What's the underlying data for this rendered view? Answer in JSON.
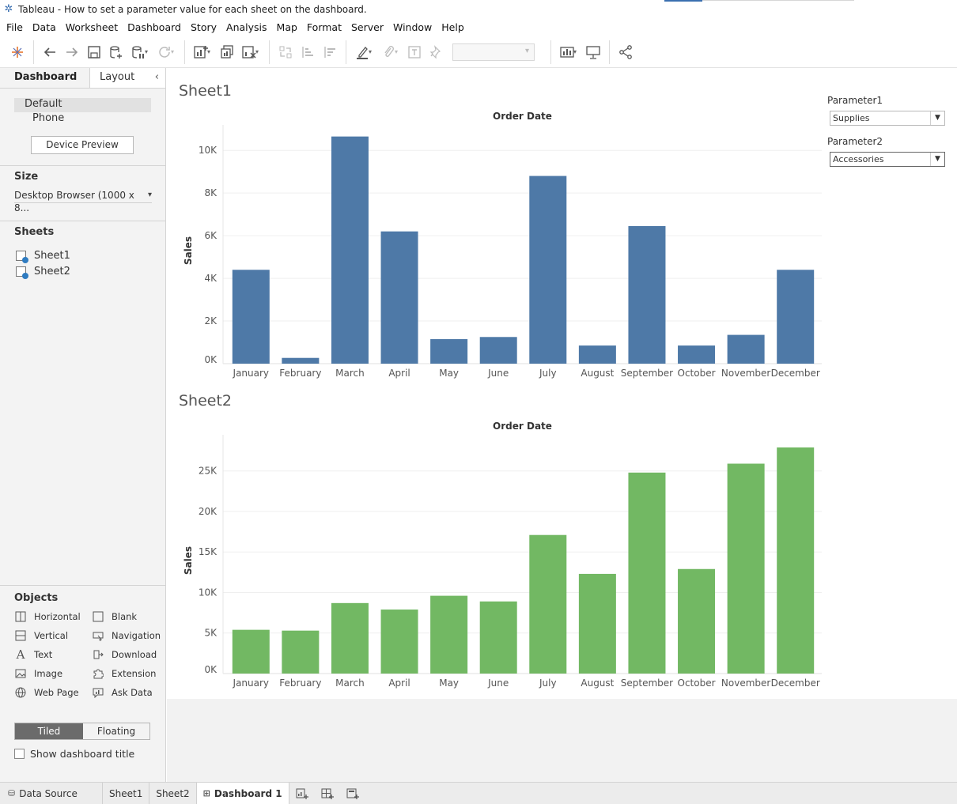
{
  "window": {
    "title": "Tableau - How to set a parameter value for each sheet on the dashboard."
  },
  "menu": [
    "File",
    "Data",
    "Worksheet",
    "Dashboard",
    "Story",
    "Analysis",
    "Map",
    "Format",
    "Server",
    "Window",
    "Help"
  ],
  "left_panel": {
    "tabs": {
      "dashboard": "Dashboard",
      "layout": "Layout"
    },
    "devices": {
      "default": "Default",
      "phone": "Phone"
    },
    "device_preview": "Device Preview",
    "size": {
      "heading": "Size",
      "value": "Desktop Browser (1000 x 8..."
    },
    "sheets": {
      "heading": "Sheets",
      "items": [
        "Sheet1",
        "Sheet2"
      ]
    },
    "objects": {
      "heading": "Objects",
      "items": [
        "Horizontal",
        "Blank",
        "Vertical",
        "Navigation",
        "Text",
        "Download",
        "Image",
        "Extension",
        "Web Page",
        "Ask Data"
      ]
    },
    "tiling": {
      "tiled": "Tiled",
      "floating": "Floating"
    },
    "show_title": "Show dashboard title"
  },
  "parameters": [
    {
      "label": "Parameter1",
      "value": "Supplies"
    },
    {
      "label": "Parameter2",
      "value": "Accessories"
    }
  ],
  "bottom_tabs": {
    "data_source": "Data Source",
    "sheet1": "Sheet1",
    "sheet2": "Sheet2",
    "dashboard": "Dashboard 1"
  },
  "chart_data": [
    {
      "type": "bar",
      "title": "Sheet1",
      "xlabel": "Order Date",
      "ylabel": "Sales",
      "categories": [
        "January",
        "February",
        "March",
        "April",
        "May",
        "June",
        "July",
        "August",
        "September",
        "October",
        "November",
        "December"
      ],
      "values": [
        4400,
        270,
        10650,
        6200,
        1150,
        1250,
        8800,
        850,
        6450,
        850,
        1350,
        4400
      ],
      "ylim": [
        0,
        10600
      ],
      "yticks": [
        0,
        2000,
        4000,
        6000,
        8000,
        10000
      ],
      "ytick_labels": [
        "0K",
        "2K",
        "4K",
        "6K",
        "8K",
        "10K"
      ],
      "color": "#4e79a7"
    },
    {
      "type": "bar",
      "title": "Sheet2",
      "xlabel": "Order Date",
      "ylabel": "Sales",
      "categories": [
        "January",
        "February",
        "March",
        "April",
        "May",
        "June",
        "July",
        "August",
        "September",
        "October",
        "November",
        "December"
      ],
      "values": [
        5400,
        5300,
        8700,
        7900,
        9600,
        8900,
        17100,
        12300,
        24800,
        12900,
        25900,
        27900
      ],
      "ylim": [
        0,
        27900
      ],
      "yticks": [
        0,
        5000,
        10000,
        15000,
        20000,
        25000
      ],
      "ytick_labels": [
        "0K",
        "5K",
        "10K",
        "15K",
        "20K",
        "25K"
      ],
      "color": "#72b863"
    }
  ]
}
